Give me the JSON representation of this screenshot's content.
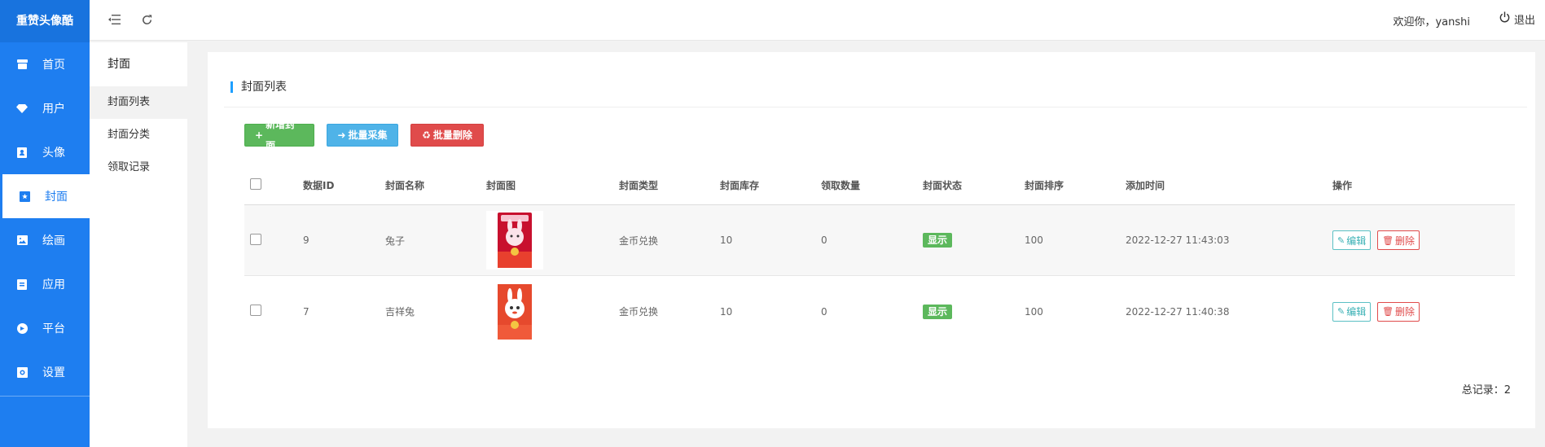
{
  "app": {
    "brand": "重赞头像酷"
  },
  "sidebar": {
    "items": [
      {
        "label": "首页",
        "icon": "home-icon"
      },
      {
        "label": "用户",
        "icon": "diamond-icon"
      },
      {
        "label": "头像",
        "icon": "portrait-icon"
      },
      {
        "label": "封面",
        "icon": "star-icon"
      },
      {
        "label": "绘画",
        "icon": "image-icon"
      },
      {
        "label": "应用",
        "icon": "app-icon"
      },
      {
        "label": "平台",
        "icon": "platform-icon"
      },
      {
        "label": "设置",
        "icon": "gear-icon"
      }
    ],
    "active": "封面"
  },
  "submenu": {
    "title": "封面",
    "items": [
      "封面列表",
      "封面分类",
      "领取记录"
    ],
    "active": "封面列表"
  },
  "header": {
    "welcome": "欢迎你，yanshi",
    "logout": "退出"
  },
  "card": {
    "title": "封面列表",
    "buttons": {
      "add": "新增封面",
      "collect": "批量采集",
      "delete": "批量删除"
    }
  },
  "table": {
    "columns": [
      "数据ID",
      "封面名称",
      "封面图",
      "封面类型",
      "封面库存",
      "领取数量",
      "封面状态",
      "封面排序",
      "添加时间",
      "操作"
    ],
    "rows": [
      {
        "id": "9",
        "name": "兔子",
        "type": "金币兑换",
        "stock": "10",
        "claimed": "0",
        "status": "显示",
        "sort": "100",
        "time": "2022-12-27 11:43:03",
        "edit": "编辑",
        "del": "删除"
      },
      {
        "id": "7",
        "name": "吉祥兔",
        "type": "金币兑换",
        "stock": "10",
        "claimed": "0",
        "status": "显示",
        "sort": "100",
        "time": "2022-12-27 11:40:38",
        "edit": "编辑",
        "del": "删除"
      }
    ]
  },
  "footer": {
    "total": "总记录：2"
  },
  "colors": {
    "sidebar": "#1e7ef0",
    "green": "#5cb85c",
    "blue": "#4fb3e8",
    "red": "#e04b4b",
    "accent": "#1e9fff"
  }
}
